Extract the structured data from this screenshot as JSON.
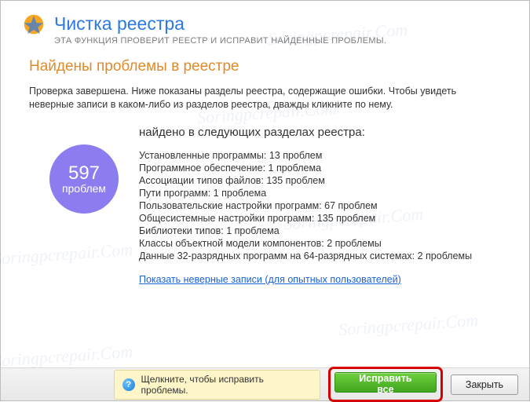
{
  "header": {
    "title": "Чистка реестра",
    "subtitle": "ЭТА ФУНКЦИЯ ПРОВЕРИТ РЕЕСТР И ИСПРАВИТ НАЙДЕННЫЕ ПРОБЛЕМЫ."
  },
  "section_title": "Найдены проблемы в реестре",
  "description": "Проверка завершена. Ниже показаны разделы реестра, содержащие ошибки. Чтобы увидеть неверные записи в каком-либо из разделов реестра, дважды кликните по нему.",
  "badge": {
    "count": "597",
    "unit": "проблем"
  },
  "found_title": "найдено в следующих разделах реестра:",
  "rows": [
    "Установленные программы: 13 проблем",
    "Программное обеспечение: 1 проблема",
    "Ассоциации типов файлов: 135 проблем",
    "Пути программ: 1 проблема",
    "Пользовательские настройки программ: 67 проблем",
    "Общесистемные настройки программ: 135 проблем",
    "Библиотеки типов: 1 проблема",
    "Классы объектной модели компонентов: 2 проблемы",
    "Данные 32-разрядных программ на 64-разрядных системах: 2 проблемы"
  ],
  "advanced_link": "Показать неверные записи (для опытных пользователей)",
  "footer": {
    "tip": "Щелкните, чтобы исправить проблемы.",
    "fix_all": "Исправить все",
    "close": "Закрыть"
  },
  "watermark": "Soringpcrepair.Com"
}
